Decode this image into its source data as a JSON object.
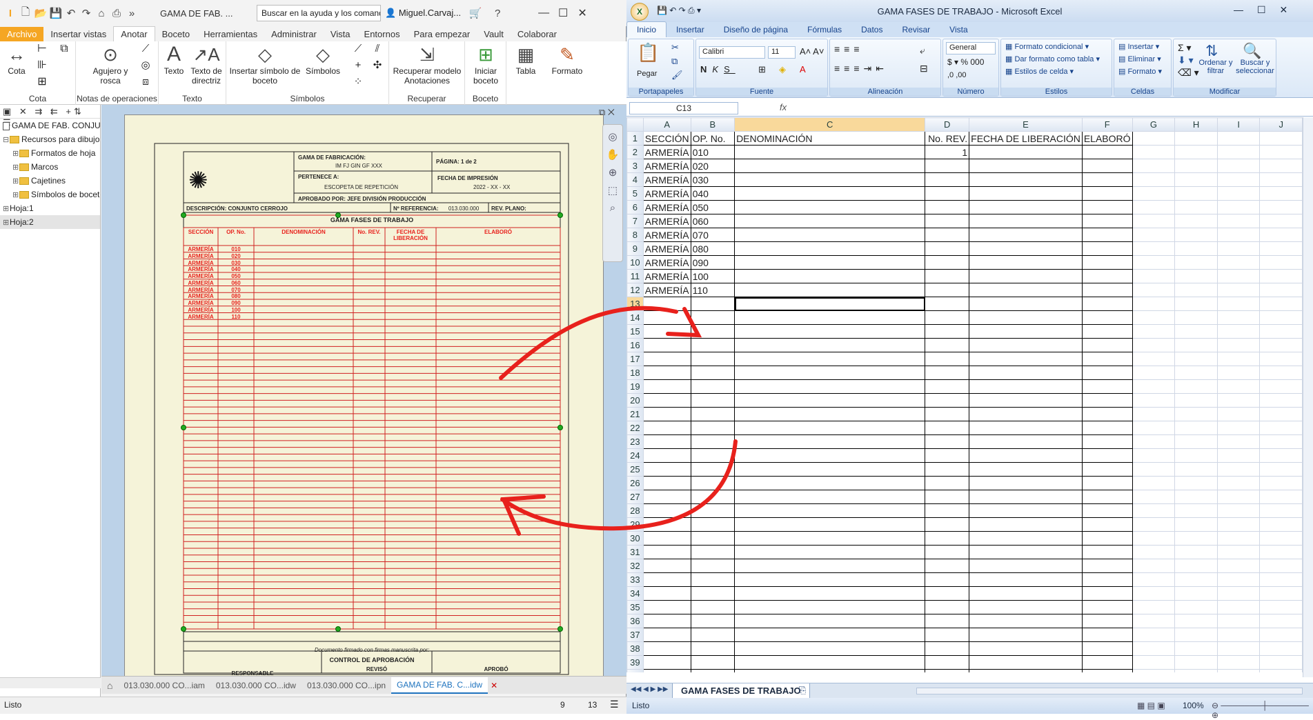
{
  "inventor": {
    "app_icon": "inventor-logo-icon",
    "doc_title": "GAMA DE FAB. ...",
    "search_placeholder": "Buscar en la ayuda y los comandos",
    "user": "Miguel.Carvaj...",
    "tabs": [
      "Archivo",
      "Insertar vistas",
      "Anotar",
      "Boceto",
      "Herramientas",
      "Administrar",
      "Vista",
      "Entornos",
      "Para empezar",
      "Vault",
      "Colaborar"
    ],
    "active_tab": "Anotar",
    "ribbon": {
      "cota": "Cota",
      "group_cota": "Cota",
      "agujero": "Agujero y rosca",
      "group_notas": "Notas de operaciones",
      "texto": "Texto",
      "texto_directriz": "Texto de directriz",
      "group_texto": "Texto",
      "insertar_simbolo": "Insertar símbolo de boceto",
      "simbolos": "Símbolos",
      "group_simbolos": "Símbolos",
      "recuperar": "Recuperar modelo Anotaciones",
      "group_recuperar": "Recuperar",
      "iniciar_boceto": "Iniciar boceto",
      "group_boceto": "Boceto",
      "tabla": "Tabla",
      "formato": "Formato"
    },
    "browser": {
      "root": "GAMA DE FAB. CONJUNT",
      "resources": "Recursos para dibujos",
      "items": [
        "Formatos de hoja",
        "Marcos",
        "Cajetines",
        "Símbolos de boceto"
      ],
      "sheets": [
        "Hoja:1",
        "Hoja:2"
      ]
    },
    "doc_tabs": [
      "013.030.000 CO...iam",
      "013.030.000 CO...idw",
      "013.030.000 CO...ipn",
      "GAMA DE FAB. C...idw"
    ],
    "status": "Listo",
    "status_nums": [
      "9",
      "13"
    ],
    "drawing": {
      "gama_label": "GAMA DE FABRICACIÓN:",
      "gama_value": "IM FJ GIN GF XXX",
      "pagina_label": "PÁGINA:",
      "pagina_value": "1",
      "pagina_de": "de",
      "pagina_total": "2",
      "pertenece_label": "PERTENECE A:",
      "pertenece_value": "ESCOPETA DE REPETICIÓN",
      "fecha_label": "FECHA DE IMPRESIÓN",
      "fecha_value": "2022 - XX - XX",
      "aprobado": "APROBADO POR: JEFE DIVISIÓN PRODUCCIÓN",
      "descripcion": "DESCRIPCIÓN: CONJUNTO CERROJO",
      "referencia_label": "Nº REFERENCIA:",
      "referencia_value": "013.030.000",
      "rev_plano": "REV. PLANO:",
      "table_title": "GAMA FASES DE TRABAJO",
      "headers": [
        "SECCIÓN",
        "OP. No.",
        "DENOMINACIÓN",
        "No. REV.",
        "FECHA DE LIBERACIÓN",
        "ELABORÓ"
      ],
      "rows": [
        [
          "ARMERÍA",
          "010"
        ],
        [
          "ARMERÍA",
          "020"
        ],
        [
          "ARMERÍA",
          "030"
        ],
        [
          "ARMERÍA",
          "040"
        ],
        [
          "ARMERÍA",
          "050"
        ],
        [
          "ARMERÍA",
          "060"
        ],
        [
          "ARMERÍA",
          "070"
        ],
        [
          "ARMERÍA",
          "080"
        ],
        [
          "ARMERÍA",
          "090"
        ],
        [
          "ARMERÍA",
          "100"
        ],
        [
          "ARMERÍA",
          "110"
        ]
      ],
      "footer_note": "Documento firmado con firmas manuscrita por:",
      "control": "CONTROL DE APROBACIÓN",
      "responsable": "RESPONSABLE",
      "reviso": "REVISÓ",
      "aprobo": "APROBÓ"
    }
  },
  "excel": {
    "title": "GAMA FASES DE TRABAJO - Microsoft Excel",
    "tabs": [
      "Inicio",
      "Insertar",
      "Diseño de página",
      "Fórmulas",
      "Datos",
      "Revisar",
      "Vista"
    ],
    "active_tab": "Inicio",
    "ribbon": {
      "pegar": "Pegar",
      "portapapeles": "Portapapeles",
      "font_name": "Calibri",
      "font_size": "11",
      "fuente": "Fuente",
      "alineacion": "Alineación",
      "number_format": "General",
      "numero": "Número",
      "formato_condicional": "Formato condicional",
      "dar_formato": "Dar formato como tabla",
      "estilos_celda": "Estilos de celda",
      "estilos": "Estilos",
      "insertar": "Insertar",
      "eliminar": "Eliminar",
      "formato": "Formato",
      "celdas": "Celdas",
      "ordenar": "Ordenar y filtrar",
      "buscar": "Buscar y seleccionar",
      "modificar": "Modificar"
    },
    "name_box": "C13",
    "fx": "fx",
    "columns": [
      "A",
      "B",
      "C",
      "D",
      "E",
      "F",
      "G",
      "H",
      "I",
      "J"
    ],
    "header_row": [
      "SECCIÓN",
      "OP. No.",
      "DENOMINACIÓN",
      "No. REV.",
      "FECHA DE LIBERACIÓN",
      "ELABORÓ"
    ],
    "rows": [
      [
        "ARMERÍA",
        "010",
        "",
        "1"
      ],
      [
        "ARMERÍA",
        "020"
      ],
      [
        "ARMERÍA",
        "030"
      ],
      [
        "ARMERÍA",
        "040"
      ],
      [
        "ARMERÍA",
        "050"
      ],
      [
        "ARMERÍA",
        "060"
      ],
      [
        "ARMERÍA",
        "070"
      ],
      [
        "ARMERÍA",
        "080"
      ],
      [
        "ARMERÍA",
        "090"
      ],
      [
        "ARMERÍA",
        "100"
      ],
      [
        "ARMERÍA",
        "110"
      ]
    ],
    "total_rows": 40,
    "selected_cell": "C13",
    "sheet_tab": "GAMA FASES DE TRABAJO",
    "status": "Listo",
    "zoom": "100%"
  },
  "annotation_color": "#e8211c"
}
